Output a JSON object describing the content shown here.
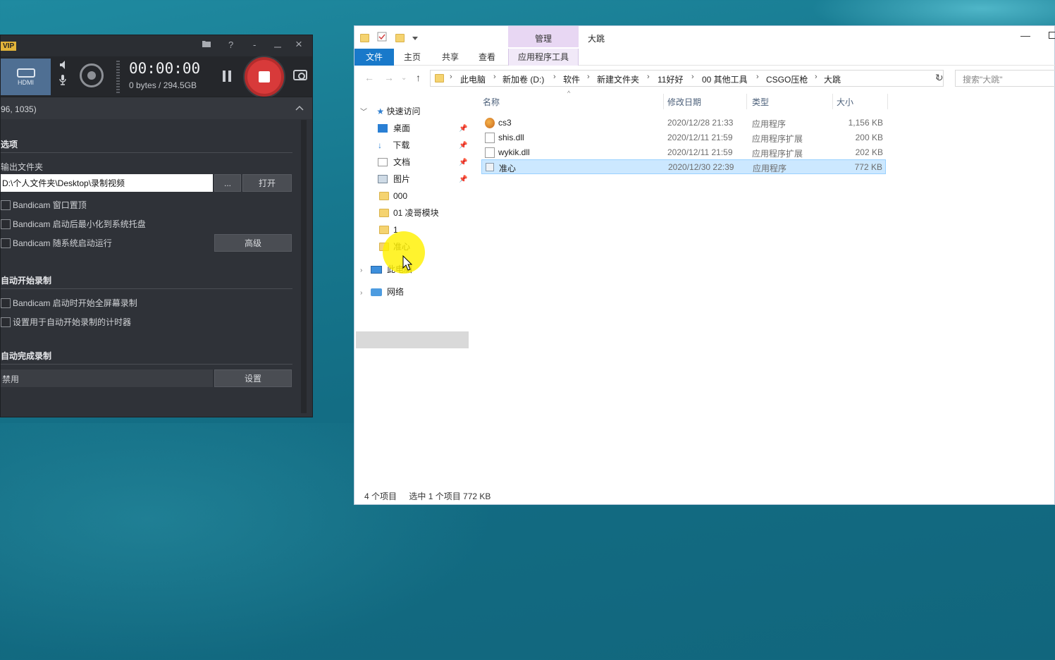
{
  "bandicam": {
    "vip_badge": "VIP",
    "title_icons": [
      "folder-icon",
      "help-icon",
      "minimize-icon",
      "close-icon"
    ],
    "help": "?",
    "minimize": "-",
    "close": "×",
    "hdmi_label": "HDMI",
    "timer": "00:00:00",
    "size_info": "0 bytes / 294.5GB",
    "coords": "96, 1035)",
    "options_header": "选项",
    "output_folder_label": "输出文件夹",
    "output_path": "D:\\个人文件夹\\Desktop\\录制视频",
    "browse_label": "...",
    "open_label": "打开",
    "checks": [
      "Bandicam 窗口置顶",
      "Bandicam 启动后最小化到系统托盘",
      "Bandicam 随系统启动运行"
    ],
    "advanced_label": "高级",
    "auto_start_header": "自动开始录制",
    "auto_start_checks": [
      "Bandicam 启动时开始全屏幕录制",
      "设置用于自动开始录制的计时器"
    ],
    "auto_finish_header": "自动完成录制",
    "auto_finish_value": "禁用",
    "settings_label": "设置"
  },
  "explorer": {
    "window_title": "大跳",
    "ribbon_context": "管理",
    "tabs": [
      "文件",
      "主页",
      "共享",
      "查看",
      "应用程序工具"
    ],
    "minimize": "—",
    "breadcrumb": [
      "此电脑",
      "新加卷 (D:)",
      "软件",
      "新建文件夹",
      "11好好",
      "00 其他工具",
      "CSGO压枪",
      "大跳"
    ],
    "search_placeholder": "搜索\"大跳\"",
    "nav": {
      "quick_access": "快速访问",
      "items": [
        "桌面",
        "下载",
        "文档",
        "图片",
        "000",
        "01 凌哥模块",
        "1",
        "准心"
      ],
      "this_pc": "此电脑",
      "network": "网络"
    },
    "columns": [
      "名称",
      "修改日期",
      "类型",
      "大小"
    ],
    "files": [
      {
        "name": "cs3",
        "date": "2020/12/28 21:33",
        "type": "应用程序",
        "size": "1,156 KB"
      },
      {
        "name": "shis.dll",
        "date": "2020/12/11 21:59",
        "type": "应用程序扩展",
        "size": "200 KB"
      },
      {
        "name": "wykik.dll",
        "date": "2020/12/11 21:59",
        "type": "应用程序扩展",
        "size": "202 KB"
      },
      {
        "name": "准心",
        "date": "2020/12/30 22:39",
        "type": "应用程序",
        "size": "772 KB"
      }
    ],
    "status_count": "4 个项目",
    "status_selected": "选中 1 个项目  772 KB"
  },
  "colors": {
    "accent_blue": "#1979ca",
    "record_red": "#d83a3a",
    "selection": "#cce8ff",
    "cursor_highlight": "#fff000"
  }
}
